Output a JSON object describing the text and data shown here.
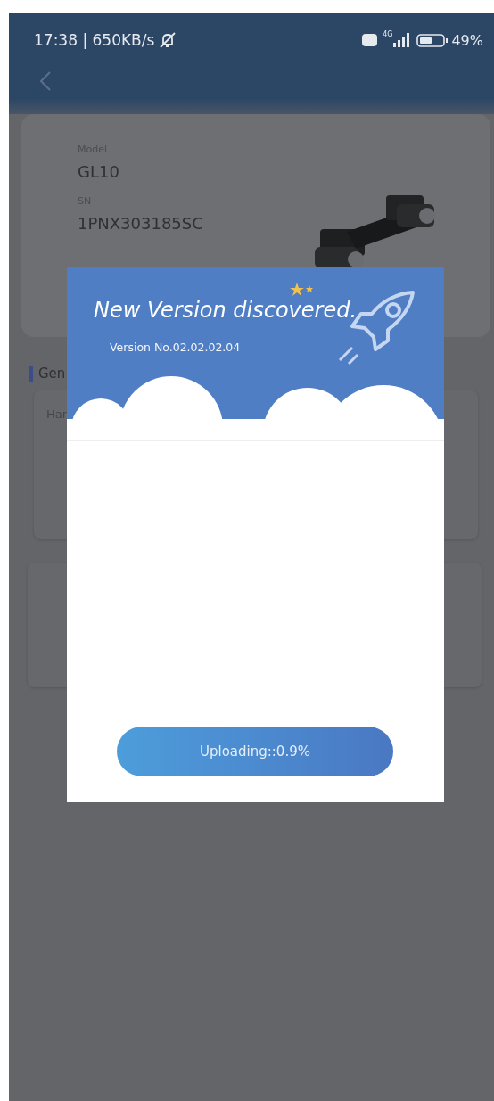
{
  "status_bar": {
    "time_speed": "17:38 | 650KB/s",
    "network": "4G",
    "battery": "49%"
  },
  "device_card": {
    "model_label": "Model",
    "model": "GL10",
    "sn_label": "SN",
    "sn": "1PNX303185SC"
  },
  "section": {
    "title": "Gen"
  },
  "hardware_card": {
    "label": "Har"
  },
  "dialog": {
    "title": "New Version discovered.",
    "version": "Version No.02.02.02.04",
    "button": "Uploading::0.9%"
  }
}
